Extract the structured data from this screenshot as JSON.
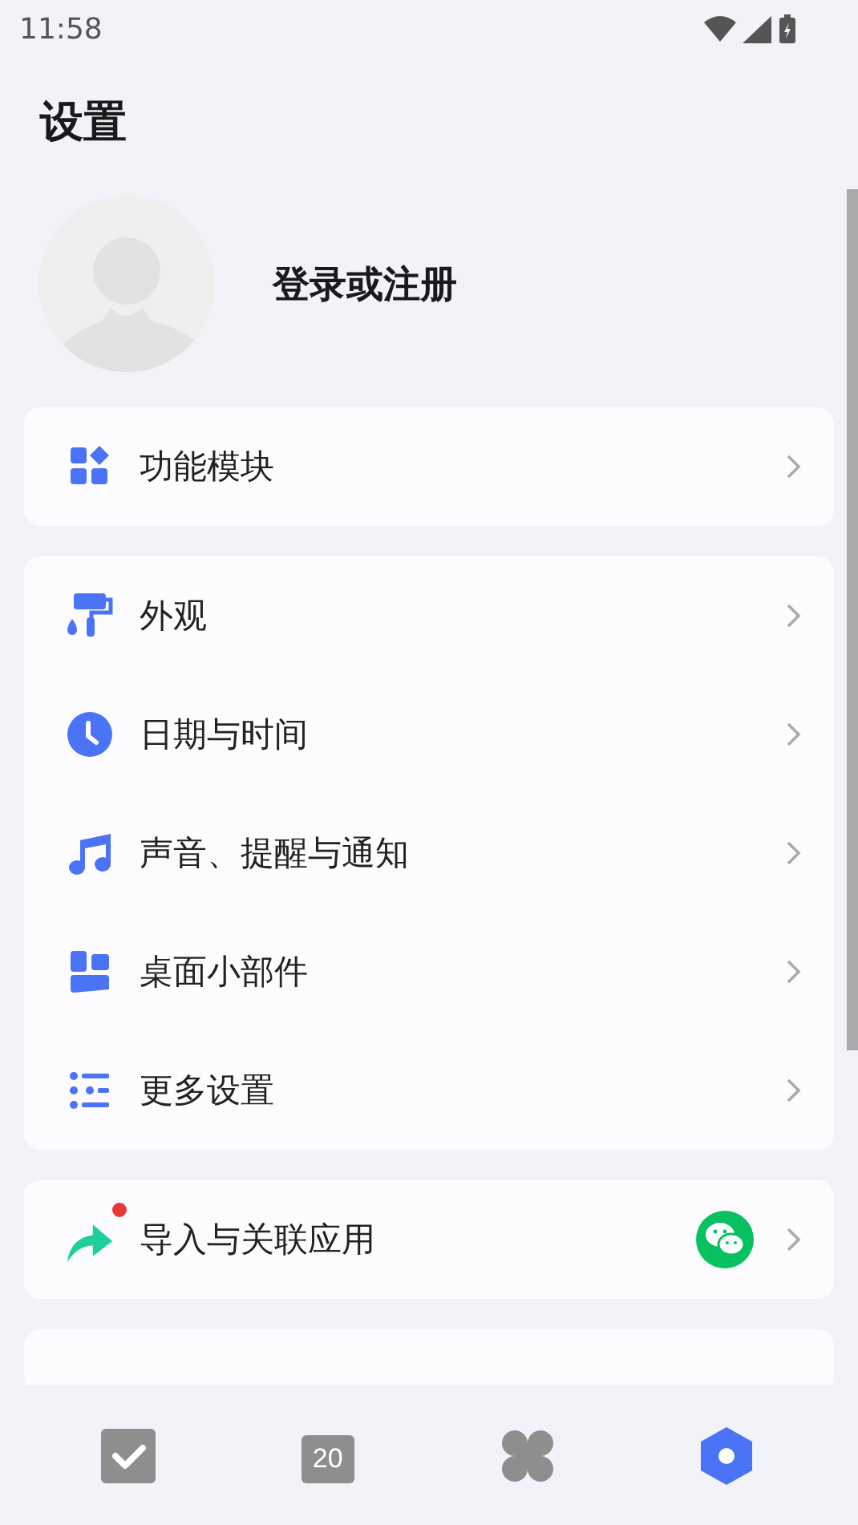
{
  "status_bar": {
    "time": "11:58"
  },
  "title": "设置",
  "account": {
    "label": "登录或注册"
  },
  "sections": [
    {
      "items": [
        {
          "label": "功能模块",
          "unread": false
        }
      ]
    },
    {
      "items": [
        {
          "label": "外观",
          "unread": false
        },
        {
          "label": "日期与时间",
          "unread": false
        },
        {
          "label": "声音、提醒与通知",
          "unread": false
        },
        {
          "label": "桌面小部件",
          "unread": false
        },
        {
          "label": "更多设置",
          "unread": false
        }
      ]
    },
    {
      "items": [
        {
          "label": "导入与关联应用",
          "unread": true
        }
      ]
    }
  ],
  "tab_bar": [
    {
      "selected": false
    },
    {
      "selected": false,
      "icon_text": "20"
    },
    {
      "selected": false
    },
    {
      "selected": true
    }
  ]
}
